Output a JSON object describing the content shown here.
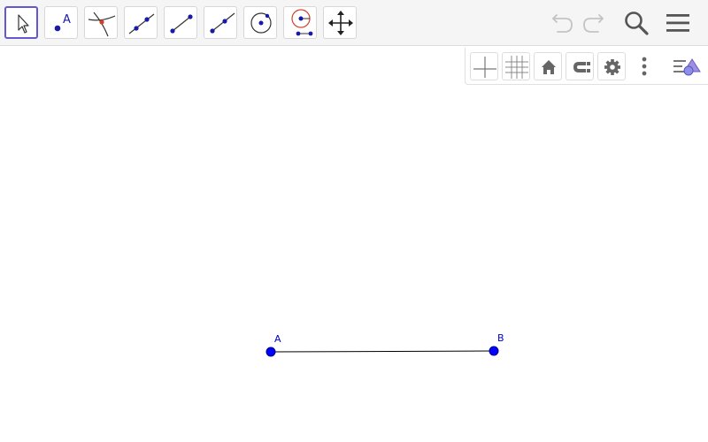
{
  "toolbar": {
    "tools": [
      {
        "icon": "move-arrow-icon",
        "selected": true
      },
      {
        "icon": "point-icon",
        "label": "A"
      },
      {
        "icon": "intersect-icon"
      },
      {
        "icon": "line-icon"
      },
      {
        "icon": "segment-icon"
      },
      {
        "icon": "ray-icon"
      },
      {
        "icon": "circle-center-point-icon"
      },
      {
        "icon": "slider-icon"
      },
      {
        "icon": "move-graphics-view-icon"
      }
    ],
    "right": [
      "undo-icon",
      "redo-icon",
      "search-icon",
      "menu-icon"
    ]
  },
  "style_bar": {
    "buttons": [
      "axes-icon",
      "grid-icon",
      "home-icon",
      "point-capturing-icon",
      "gear-icon",
      "more-options-icon",
      "algebra-toggle-icon"
    ]
  },
  "graphics": {
    "points": [
      {
        "name": "A",
        "x": 0,
        "y": 0
      },
      {
        "name": "B",
        "x": 1,
        "y": 0
      }
    ],
    "segment": {
      "from": "A",
      "to": "B"
    },
    "colors": {
      "point": "#0000ff",
      "label": "#0000cc",
      "segment": "#000000",
      "accent": "#6557d2"
    }
  }
}
